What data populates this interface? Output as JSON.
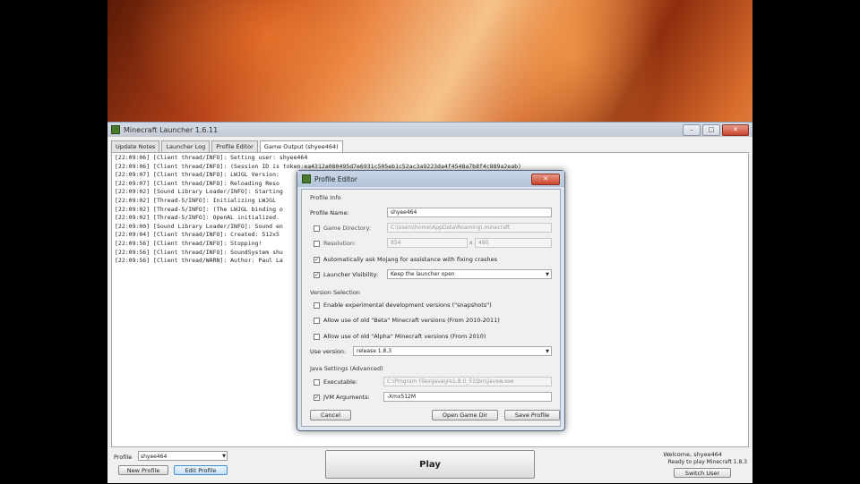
{
  "window": {
    "title": "Minecraft Launcher 1.6.11",
    "minimize": "–",
    "maximize": "□",
    "close": "✕"
  },
  "tabs": [
    "Update Notes",
    "Launcher Log",
    "Profile Editor",
    "Game Output (shyee464)"
  ],
  "console_lines": [
    "[22:09:06] [Client thread/INFO]: Setting user: shyee464",
    "[22:09:06] [Client thread/INFO]: (Session ID is token:ea4312a080495d7e6931c505eb1c52ac3a9223da4f4548a7b8f4c889a2eab)",
    "[22:09:07] [Client thread/INFO]: LWJGL Version:",
    "[22:09:07] [Client thread/INFO]: Reloading Reso",
    "[22:09:02] [Sound Library Loader/INFO]: Starting",
    "[22:09:02] [Thread-5/INFO]: Initializing LWJGL",
    "[22:09:02] [Thread-5/INFO]: (The LWJGL binding o",
    "[22:09:02] [Thread-5/INFO]: OpenAL initialized.",
    "[22:09:00] [Sound Library Loader/INFO]: Sound en",
    "[22:09:04] [Client thread/INFO]: Created: 512x5",
    "[22:09:56] [Client thread/INFO]: Stopping!",
    "[22:09:56] [Client thread/INFO]: SoundSystem shu",
    "[22:09:56] [Client thread/WARN]: Author: Paul La"
  ],
  "bottom": {
    "profile_label": "Profile",
    "profile_value": "shyee464",
    "new_profile": "New Profile",
    "edit_profile": "Edit Profile",
    "play": "Play",
    "welcome": "Welcome, shyee464",
    "ready": "Ready to play Minecraft 1.8.3",
    "switch_user": "Switch User"
  },
  "dialog": {
    "title": "Profile Editor",
    "close": "✕",
    "profile_info": "Profile Info",
    "profile_name_label": "Profile Name:",
    "profile_name_value": "shyee464",
    "game_directory_label": "Game Directory:",
    "game_directory_value": "C:\\Users\\home\\AppData\\Roaming\\.minecraft",
    "resolution_label": "Resolution:",
    "resolution_width": "854",
    "resolution_x": "x",
    "resolution_height": "480",
    "auto_ask_label": "Automatically ask Mojang for assistance with fixing crashes",
    "launcher_visibility_label": "Launcher Visibility:",
    "launcher_visibility_value": "Keep the launcher open",
    "version_selection": "Version Selection",
    "snapshots_label": "Enable experimental development versions (\"snapshots\")",
    "beta_label": "Allow use of old \"Beta\" Minecraft versions (From 2010-2011)",
    "alpha_label": "Allow use of old \"Alpha\" Minecraft versions (From 2010)",
    "use_version_label": "Use version:",
    "use_version_value": "release 1.8.3",
    "java_settings": "Java Settings (Advanced)",
    "executable_label": "Executable:",
    "executable_value": "C:\\Program Files\\Java\\jre1.8.0_51\\bin\\javaw.exe",
    "jvm_label": "JVM Arguments:",
    "jvm_value": "-Xmx512M",
    "check_mark": "✓",
    "cancel": "Cancel",
    "open_game_dir": "Open Game Dir",
    "save_profile": "Save Profile"
  }
}
